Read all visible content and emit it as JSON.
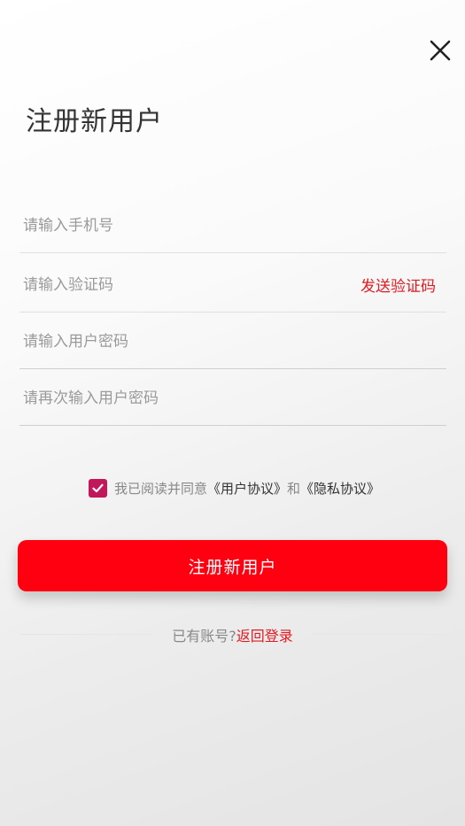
{
  "close_icon": "close-icon",
  "title": "注册新用户",
  "fields": {
    "phone_placeholder": "请输入手机号",
    "code_placeholder": "请输入验证码",
    "send_code_label": "发送验证码",
    "password_placeholder": "请输入用户密码",
    "password_confirm_placeholder": "请再次输入用户密码"
  },
  "agreement": {
    "checked": true,
    "prefix": "我已阅读并同意",
    "user_agreement": "《用户协议》",
    "and": "和",
    "privacy_policy": "《隐私协议》"
  },
  "submit_label": "注册新用户",
  "login_prompt": {
    "question": "已有账号?",
    "link": "返回登录"
  },
  "colors": {
    "accent": "#ff0010",
    "link_red": "#e01b22",
    "checkbox": "#c2185b"
  }
}
